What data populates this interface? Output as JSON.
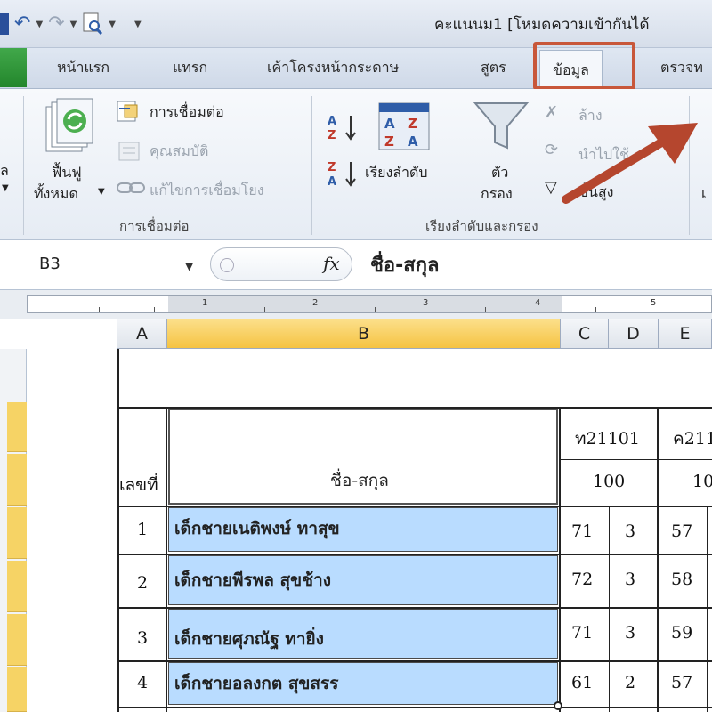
{
  "window": {
    "title": "คะแนนม1  [โหมดความเข้ากันได้"
  },
  "ribbon_tabs": [
    "หน้าแรก",
    "แทรก",
    "เค้าโครงหน้ากระดาษ",
    "สูตร",
    "ข้อมูล",
    "ตรวจท"
  ],
  "ribbon": {
    "left_cut_label_1": "ล",
    "refresh_all_label_1": "ฟื้นฟู",
    "refresh_all_label_2": "ทั้งหมด",
    "connections": "การเชื่อมต่อ",
    "properties": "คุณสมบัติ",
    "edit_links": "แก้ไขการเชื่อมโยง",
    "group_connections": "การเชื่อมต่อ",
    "sort": "เรียงลำดับ",
    "filter_1": "ตัว",
    "filter_2": "กรอง",
    "clear": "ล้าง",
    "reapply": "นำไปใช้",
    "advanced": "ขั้นสูง",
    "group_sort_filter": "เรียงลำดับและกรอง",
    "right_cut_label": "เ"
  },
  "formula_bar": {
    "name_box": "B3",
    "fx": "fx",
    "content": "ชื่อ-สกุล"
  },
  "ruler_numbers": [
    "1",
    "2",
    "3",
    "4",
    "5"
  ],
  "columns": [
    "A",
    "B",
    "C",
    "D",
    "E"
  ],
  "table": {
    "header_col1": "เลขที่",
    "header_name": "ชื่อ-สกุล",
    "subject1_code": "ท21101",
    "subject1_max": "100",
    "subject2_code": "ค211",
    "subject2_max": "10",
    "rows": [
      {
        "no": "1",
        "name": "เด็กชายเนติพงษ์  ทาสุข",
        "score": "71",
        "grade": "3",
        "score2": "57"
      },
      {
        "no": "2",
        "name": "เด็กชายพีรพล  สุขช้าง",
        "score": "72",
        "grade": "3",
        "score2": "58"
      },
      {
        "no": "3",
        "name": "เด็กชายศุภณัฐ  ทายิ่ง",
        "score": "71",
        "grade": "3",
        "score2": "59"
      },
      {
        "no": "4",
        "name": "เด็กชายอลงกต  สุขสรร",
        "score": "61",
        "grade": "2",
        "score2": "57"
      }
    ]
  },
  "colors": {
    "highlight_box": "#c8573a",
    "arrow": "#b5462e",
    "selected_header": "#f5c342",
    "name_cell_fill": "#b9dcff"
  }
}
